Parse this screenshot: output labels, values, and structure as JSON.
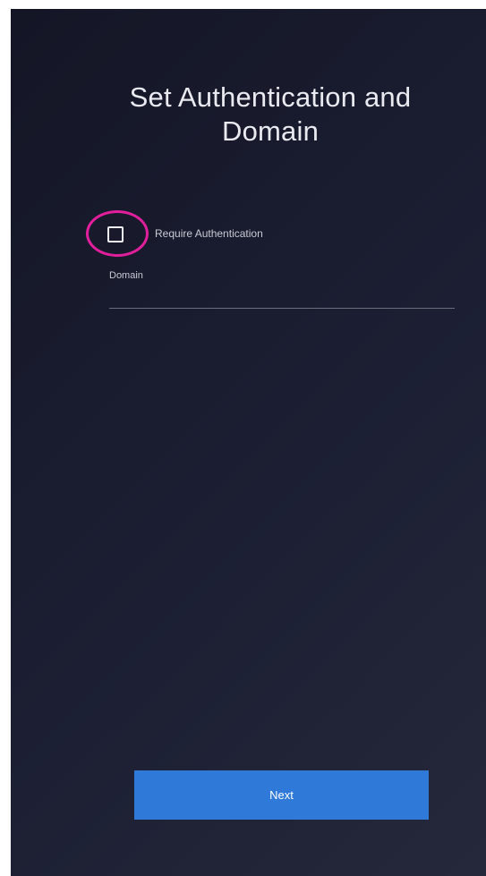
{
  "page": {
    "title": "Set Authentication and Domain"
  },
  "auth": {
    "checkbox_label": "Require Authentication",
    "checked": false
  },
  "domain": {
    "label": "Domain",
    "value": ""
  },
  "actions": {
    "next_label": "Next"
  },
  "colors": {
    "background": "#1c1f33",
    "highlight": "#e11f9c",
    "button": "#2f79d9"
  }
}
